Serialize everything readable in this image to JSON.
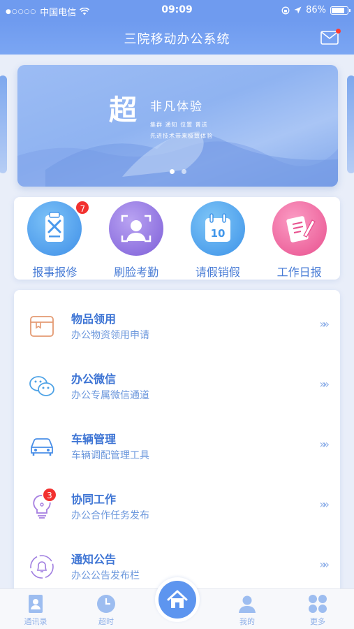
{
  "status_bar": {
    "signal_dots": "●○○○○",
    "carrier": "中国电信",
    "time": "09:09",
    "battery_percent": "86%",
    "battery_level": 0.86
  },
  "nav": {
    "title": "三院移动办公系统",
    "mail_icon": "mail-icon",
    "has_notification_dot": true
  },
  "banner": {
    "headline_big": "超",
    "headline_sub": "非凡体验",
    "tagline_1": "集群 通知 位置 普送",
    "tagline_2": "先进技术带来极致体验",
    "page_indicator": {
      "total": 2,
      "active": 1
    }
  },
  "shortcuts": [
    {
      "label": "报事报修",
      "icon": "repair-icon",
      "badge": "7",
      "color": "#53a5f0"
    },
    {
      "label": "刷脸考勤",
      "icon": "face-scan-icon",
      "badge": "",
      "color": "#9b7fe6"
    },
    {
      "label": "请假销假",
      "icon": "calendar-icon",
      "badge": "",
      "color": "#4ea8f2",
      "calendar_number": "10"
    },
    {
      "label": "工作日报",
      "icon": "report-pen-icon",
      "badge": "",
      "color": "#f06fa4"
    }
  ],
  "list_items": [
    {
      "title": "物品领用",
      "desc": "办公物资领用申请",
      "icon": "supplies-icon",
      "badge": ""
    },
    {
      "title": "办公微信",
      "desc": "办公专属微信通道",
      "icon": "chat-icon",
      "badge": ""
    },
    {
      "title": "车辆管理",
      "desc": "车辆调配管理工具",
      "icon": "car-icon",
      "badge": ""
    },
    {
      "title": "协同工作",
      "desc": "办公合作任务发布",
      "icon": "lightbulb-icon",
      "badge": "3"
    },
    {
      "title": "通知公告",
      "desc": "办公公告发布栏",
      "icon": "bell-icon",
      "badge": ""
    }
  ],
  "chevron": "»»",
  "tabbar": [
    {
      "label": "通讯录",
      "icon": "contacts-icon"
    },
    {
      "label": "超时",
      "icon": "clock-icon"
    },
    {
      "label": "",
      "icon": "home-icon"
    },
    {
      "label": "我的",
      "icon": "profile-icon"
    },
    {
      "label": "更多",
      "icon": "more-icon"
    }
  ],
  "colors": {
    "primary": "#6f9bef",
    "text_blue": "#3d74d4",
    "badge_red": "#f2312f"
  }
}
